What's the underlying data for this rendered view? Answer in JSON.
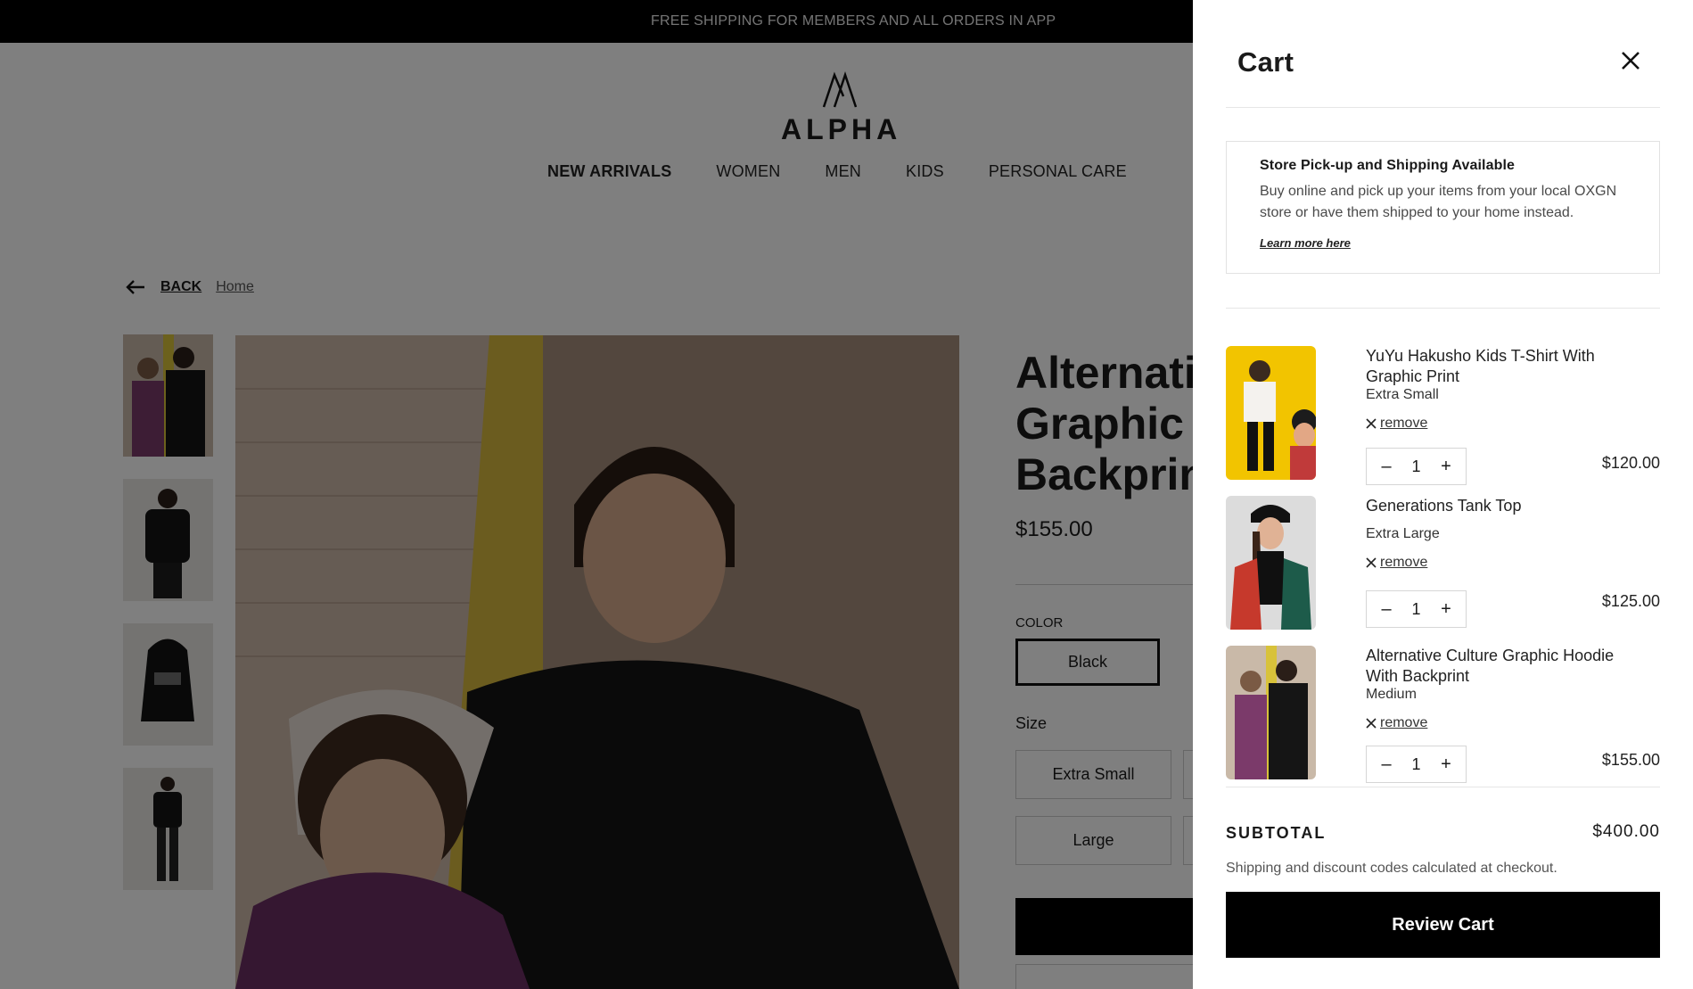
{
  "announcement": "FREE SHIPPING FOR MEMBERS AND ALL ORDERS IN APP",
  "logo": {
    "text": "ALPHA"
  },
  "nav": {
    "items": [
      "NEW ARRIVALS",
      "WOMEN",
      "MEN",
      "KIDS",
      "PERSONAL CARE"
    ]
  },
  "breadcrumb": {
    "back": "BACK",
    "home": "Home"
  },
  "product": {
    "title_lines": [
      "Alternati",
      "Graphic I",
      "Backprin"
    ],
    "price": "$155.00",
    "color_label": "COLOR",
    "color_value": "Black",
    "size_label": "Size",
    "sizes": [
      "Extra Small",
      "Large"
    ]
  },
  "cart": {
    "title": "Cart",
    "info": {
      "title": "Store Pick-up and Shipping Available",
      "body": "Buy online and pick up your items from your local OXGN store or have them shipped to your home instead.",
      "link": "Learn more here"
    },
    "remove_label": "remove",
    "items": [
      {
        "name": "YuYu Hakusho Kids T-Shirt With Graphic Print",
        "variant": "Extra Small",
        "qty": "1",
        "price": "$120.00"
      },
      {
        "name": "Generations Tank Top",
        "variant": "Extra Large",
        "qty": "1",
        "price": "$125.00"
      },
      {
        "name": "Alternative Culture Graphic Hoodie With Backprint",
        "variant": "Medium",
        "qty": "1",
        "price": "$155.00"
      }
    ],
    "subtotal_label": "SUBTOTAL",
    "subtotal_value": "$400.00",
    "shipping_note": "Shipping and discount codes calculated at checkout.",
    "review_button": "Review Cart"
  },
  "colors": {
    "overlay": "#000000",
    "button": "#000000",
    "accent": "#f5c400"
  },
  "icons": [
    "arrow-left-icon",
    "close-icon",
    "remove-x-icon",
    "minus-icon",
    "plus-icon"
  ]
}
